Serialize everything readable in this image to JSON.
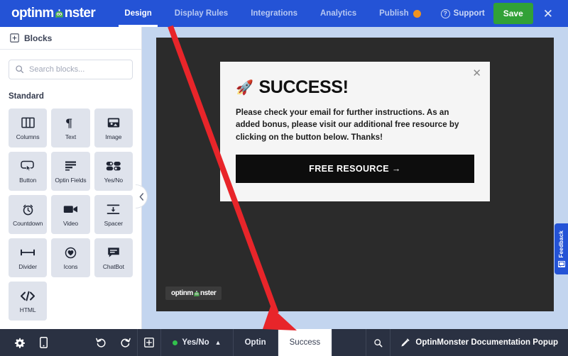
{
  "topbar": {
    "brand": "optinm nster",
    "brand_prefix": "optinm",
    "brand_suffix": "nster",
    "nav": [
      {
        "label": "Design",
        "active": true,
        "badge": null
      },
      {
        "label": "Display Rules",
        "active": false,
        "badge": null
      },
      {
        "label": "Integrations",
        "active": false,
        "badge": null
      },
      {
        "label": "Analytics",
        "active": false,
        "badge": null
      },
      {
        "label": "Publish",
        "active": false,
        "badge": "dot"
      }
    ],
    "support_label": "Support",
    "support_icon": "question-circle-icon",
    "save_label": "Save",
    "close_icon": "close-icon",
    "colors": {
      "bar": "#2453d6",
      "save": "#31a137",
      "badge": "#f0931f"
    }
  },
  "sidebar": {
    "header_label": "Blocks",
    "header_icon": "blocks-icon",
    "search": {
      "placeholder": "Search blocks...",
      "value": "",
      "icon": "search-icon"
    },
    "section_title": "Standard",
    "blocks": [
      {
        "label": "Columns",
        "icon": "columns-icon"
      },
      {
        "label": "Text",
        "icon": "paragraph-icon"
      },
      {
        "label": "Image",
        "icon": "image-icon"
      },
      {
        "label": "Button",
        "icon": "button-icon"
      },
      {
        "label": "Optin Fields",
        "icon": "optin-fields-icon"
      },
      {
        "label": "Yes/No",
        "icon": "yes-no-icon"
      },
      {
        "label": "Countdown",
        "icon": "countdown-icon"
      },
      {
        "label": "Video",
        "icon": "video-icon"
      },
      {
        "label": "Spacer",
        "icon": "spacer-icon"
      },
      {
        "label": "Divider",
        "icon": "divider-icon"
      },
      {
        "label": "Icons",
        "icon": "icons-icon"
      },
      {
        "label": "ChatBot",
        "icon": "chatbot-icon"
      },
      {
        "label": "HTML",
        "icon": "html-icon"
      }
    ],
    "collapse_icon": "chevron-left-icon"
  },
  "canvas": {
    "popup": {
      "close_icon": "close-icon",
      "emoji": "🚀",
      "title": "SUCCESS!",
      "body": "Please check your email for further instructions. As an added bonus, please visit our additional free resource by clicking on the button below. Thanks!",
      "cta_label": "FREE RESOURCE →"
    },
    "watermark_prefix": "optinm",
    "watermark_suffix": "nster",
    "background_color": "#2b2b2b"
  },
  "feedback": {
    "label": "Feedback",
    "icon": "feedback-icon"
  },
  "bottombar": {
    "tools": [
      {
        "name": "settings-button",
        "icon": "gear-icon"
      },
      {
        "name": "mobile-preview-button",
        "icon": "mobile-icon"
      }
    ],
    "history": [
      {
        "name": "undo-button",
        "icon": "undo-icon"
      },
      {
        "name": "redo-button",
        "icon": "redo-icon"
      }
    ],
    "add_view_icon": "add-box-icon",
    "views": [
      {
        "label": "Yes/No",
        "active": false,
        "dot": true,
        "caret": "^"
      },
      {
        "label": "Optin",
        "active": false,
        "dot": false,
        "caret": null
      },
      {
        "label": "Success",
        "active": true,
        "dot": false,
        "caret": null
      }
    ],
    "search_icon": "search-icon",
    "campaign_name": "OptinMonster Documentation Popup",
    "campaign_edit_icon": "pencil-icon"
  },
  "annotation": {
    "type": "red-arrow",
    "color": "#e8252a"
  }
}
